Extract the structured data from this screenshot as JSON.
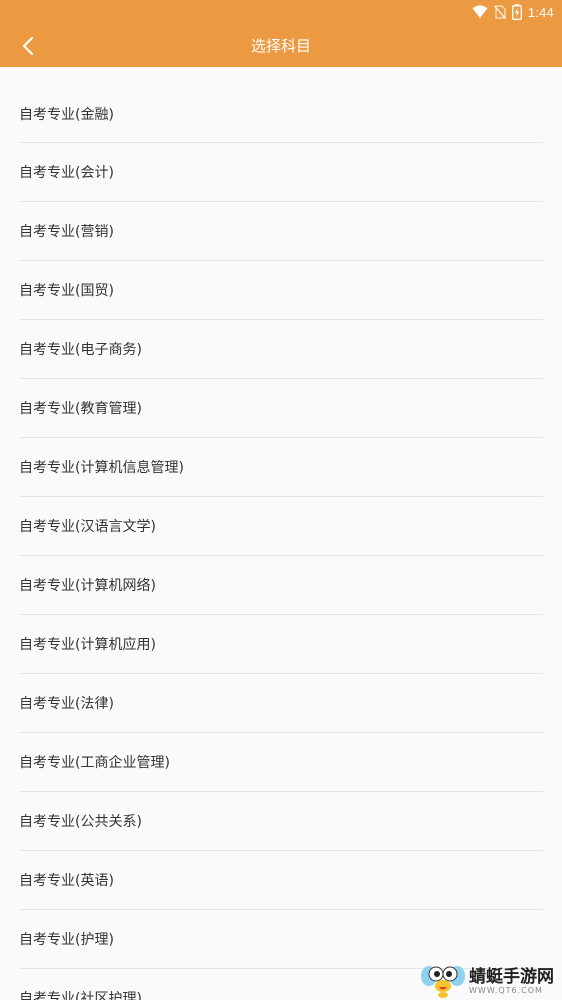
{
  "status_bar": {
    "time": "1:44",
    "icons": [
      "wifi-icon",
      "no-sim-icon",
      "battery-charging-icon"
    ]
  },
  "header": {
    "title": "选择科目",
    "back_icon": "chevron-left-icon"
  },
  "list": {
    "items": [
      {
        "label": "自考专业(金融)"
      },
      {
        "label": "自考专业(会计)"
      },
      {
        "label": "自考专业(营销)"
      },
      {
        "label": "自考专业(国贸)"
      },
      {
        "label": "自考专业(电子商务)"
      },
      {
        "label": "自考专业(教育管理)"
      },
      {
        "label": "自考专业(计算机信息管理)"
      },
      {
        "label": "自考专业(汉语言文学)"
      },
      {
        "label": "自考专业(计算机网络)"
      },
      {
        "label": "自考专业(计算机应用)"
      },
      {
        "label": "自考专业(法律)"
      },
      {
        "label": "自考专业(工商企业管理)"
      },
      {
        "label": "自考专业(公共关系)"
      },
      {
        "label": "自考专业(英语)"
      },
      {
        "label": "自考专业(护理)"
      },
      {
        "label": "自考专业(社区护理)"
      }
    ]
  },
  "watermark": {
    "title": "蜻蜓手游网",
    "url": "WWW.QT6.COM"
  },
  "colors": {
    "accent": "#ec9a41",
    "text": "#333333",
    "divider": "#e5e5e5",
    "background": "#fafafa"
  }
}
